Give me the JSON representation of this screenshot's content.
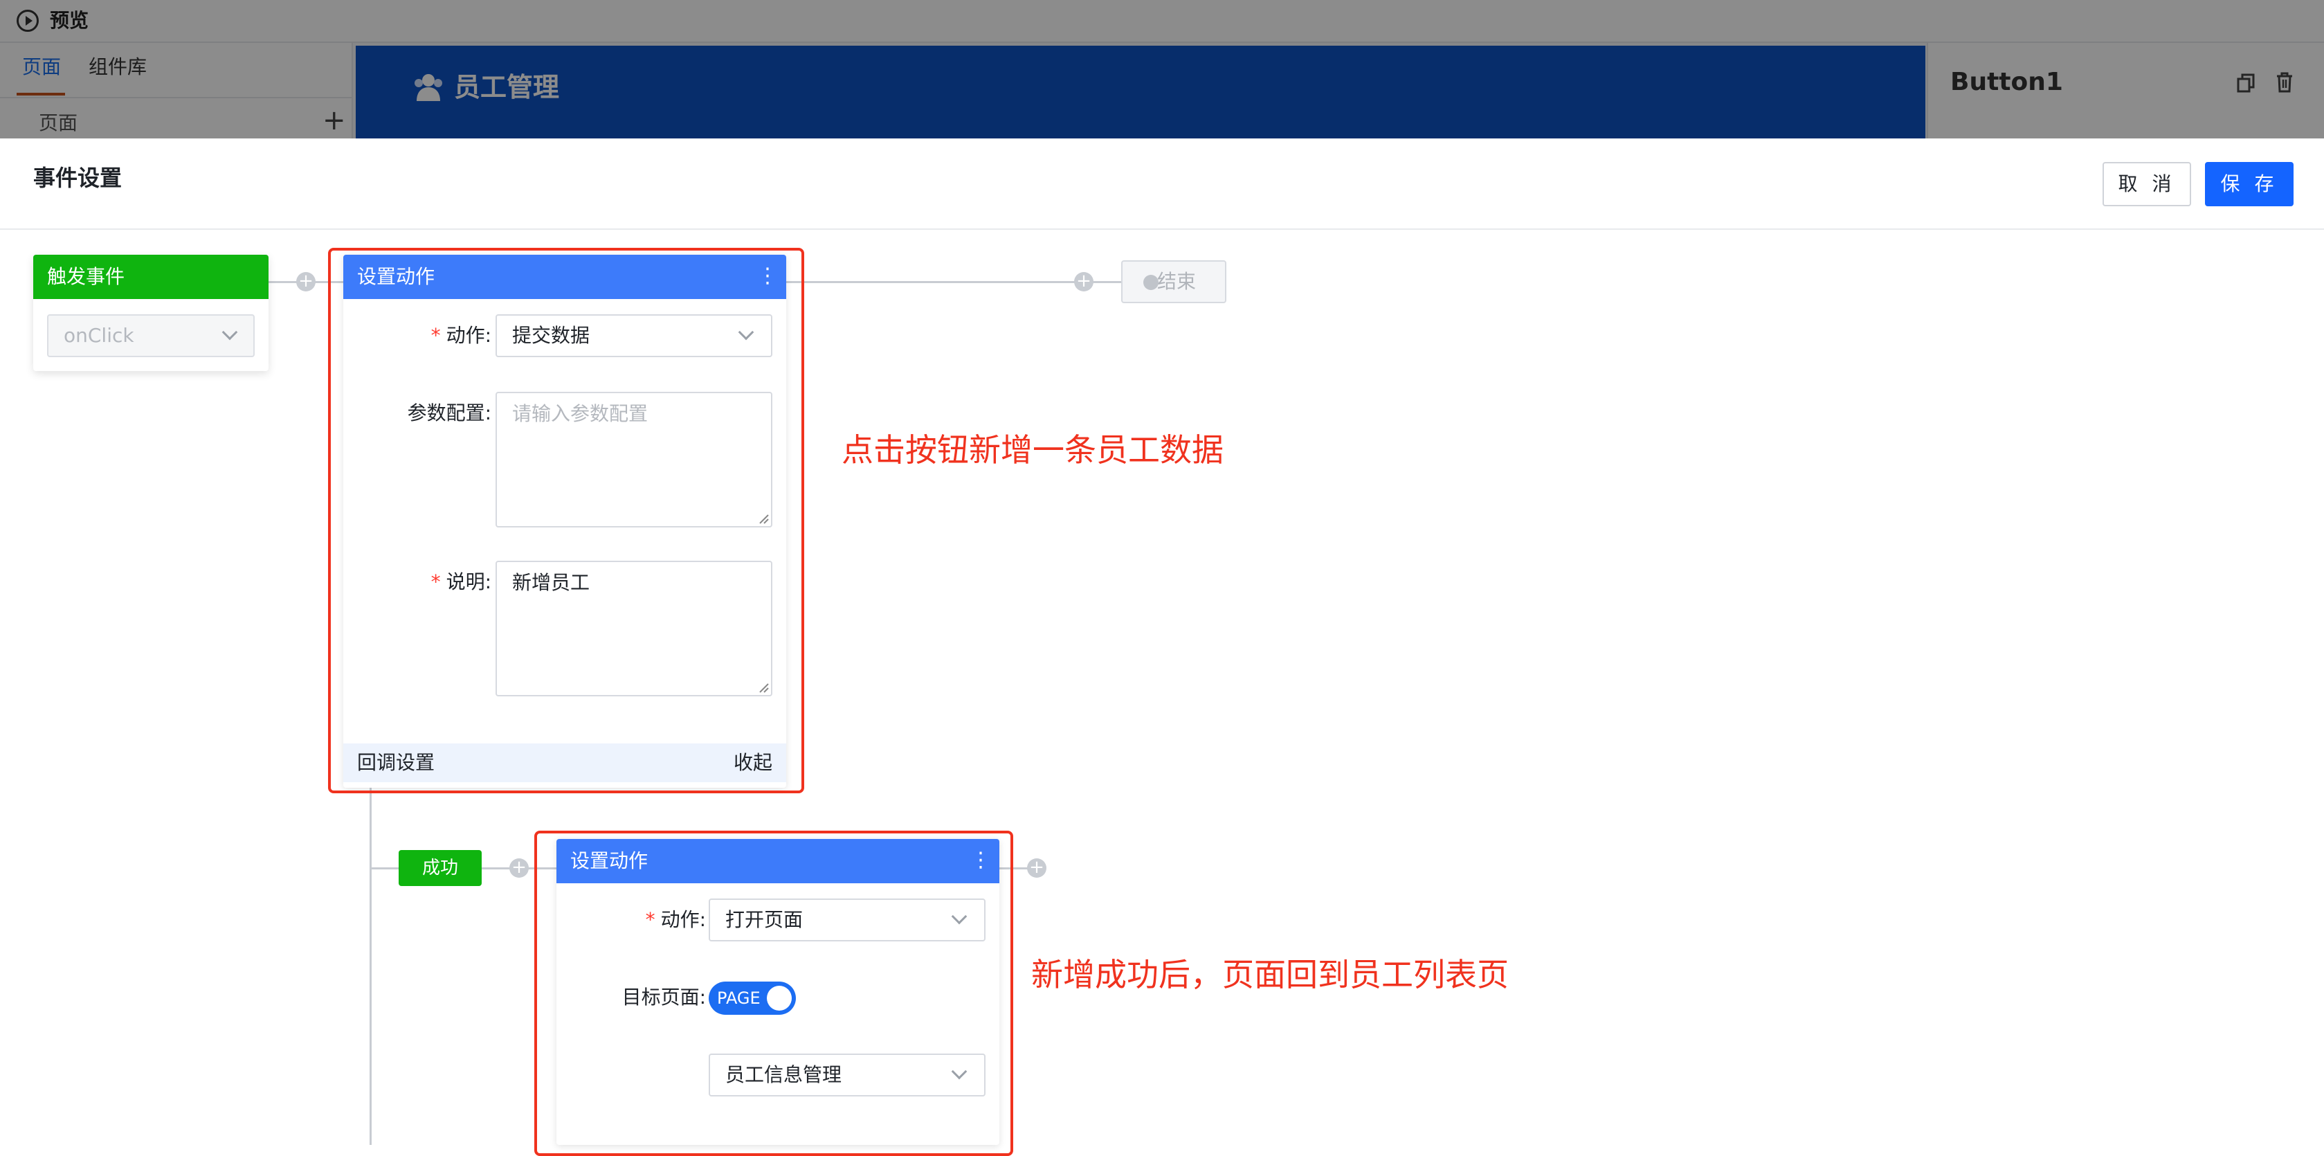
{
  "topbar": {
    "preview_label": "预览"
  },
  "left_panel": {
    "tabs": [
      {
        "label": "页面",
        "active": true
      },
      {
        "label": "组件库",
        "active": false
      }
    ],
    "pages_label": "页面",
    "add_glyph": "+"
  },
  "canvas": {
    "header_title": "员工管理",
    "header_icon": "users-icon",
    "header_color": "#0e52c4"
  },
  "right_panel": {
    "selected_component": "Button1",
    "icons": [
      "copy-icon",
      "trash-icon"
    ]
  },
  "dialog": {
    "title": "事件设置",
    "cancel_label": "取 消",
    "save_label": "保 存",
    "primary_color": "#1464ff"
  },
  "flow": {
    "trigger": {
      "header": "触发事件",
      "event_value": "onClick",
      "color": "#0fb40f"
    },
    "action1": {
      "header": "设置动作",
      "action_label": "动作:",
      "action_value": "提交数据",
      "params_label": "参数配置:",
      "params_placeholder": "请输入参数配置",
      "desc_label": "说明:",
      "desc_value": "新增员工",
      "callback_label": "回调设置",
      "collapse_label": "收起"
    },
    "end_label": "结束",
    "success_label": "成功",
    "action2": {
      "header": "设置动作",
      "action_label": "动作:",
      "action_value": "打开页面",
      "target_label": "目标页面:",
      "toggle_text": "PAGE",
      "target_value": "员工信息管理"
    },
    "plus_glyph": "+",
    "kebab_glyph": "⋮",
    "required_mark": "*"
  },
  "annotations": {
    "note1": "点击按钮新增一条员工数据",
    "note2": "新增成功后，页面回到员工列表页",
    "color": "#f0321e"
  }
}
